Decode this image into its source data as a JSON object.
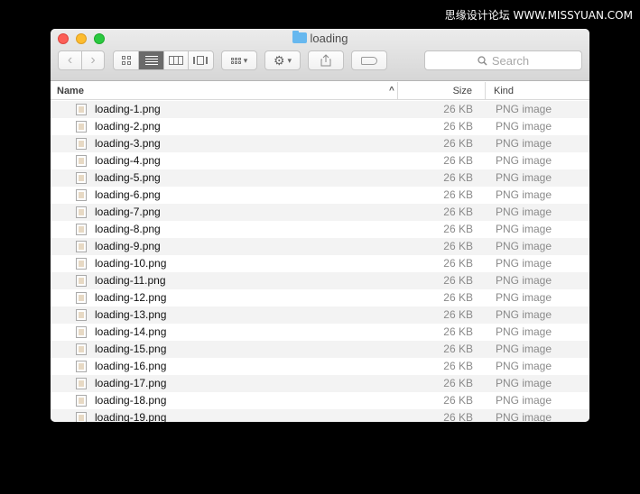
{
  "watermark": "思缘设计论坛  WWW.MISSYUAN.COM",
  "window": {
    "title": "loading"
  },
  "search": {
    "placeholder": "Search"
  },
  "columns": {
    "name": "Name",
    "size": "Size",
    "kind": "Kind"
  },
  "files": [
    {
      "name": "loading-1.png",
      "size": "26 KB",
      "kind": "PNG image"
    },
    {
      "name": "loading-2.png",
      "size": "26 KB",
      "kind": "PNG image"
    },
    {
      "name": "loading-3.png",
      "size": "26 KB",
      "kind": "PNG image"
    },
    {
      "name": "loading-4.png",
      "size": "26 KB",
      "kind": "PNG image"
    },
    {
      "name": "loading-5.png",
      "size": "26 KB",
      "kind": "PNG image"
    },
    {
      "name": "loading-6.png",
      "size": "26 KB",
      "kind": "PNG image"
    },
    {
      "name": "loading-7.png",
      "size": "26 KB",
      "kind": "PNG image"
    },
    {
      "name": "loading-8.png",
      "size": "26 KB",
      "kind": "PNG image"
    },
    {
      "name": "loading-9.png",
      "size": "26 KB",
      "kind": "PNG image"
    },
    {
      "name": "loading-10.png",
      "size": "26 KB",
      "kind": "PNG image"
    },
    {
      "name": "loading-11.png",
      "size": "26 KB",
      "kind": "PNG image"
    },
    {
      "name": "loading-12.png",
      "size": "26 KB",
      "kind": "PNG image"
    },
    {
      "name": "loading-13.png",
      "size": "26 KB",
      "kind": "PNG image"
    },
    {
      "name": "loading-14.png",
      "size": "26 KB",
      "kind": "PNG image"
    },
    {
      "name": "loading-15.png",
      "size": "26 KB",
      "kind": "PNG image"
    },
    {
      "name": "loading-16.png",
      "size": "26 KB",
      "kind": "PNG image"
    },
    {
      "name": "loading-17.png",
      "size": "26 KB",
      "kind": "PNG image"
    },
    {
      "name": "loading-18.png",
      "size": "26 KB",
      "kind": "PNG image"
    },
    {
      "name": "loading-19.png",
      "size": "26 KB",
      "kind": "PNG image"
    }
  ],
  "colors": {
    "close": "#fc5f57",
    "minimize": "#fdbc2e",
    "maximize": "#2ac940",
    "folder": "#67b8ef",
    "active_view": "#6a6a6a"
  },
  "icons": [
    "back-icon",
    "forward-icon",
    "icon-view-icon",
    "list-view-icon",
    "column-view-icon",
    "cover-flow-icon",
    "arrange-icon",
    "gear-icon",
    "share-icon",
    "tag-icon",
    "search-icon",
    "file-icon"
  ]
}
